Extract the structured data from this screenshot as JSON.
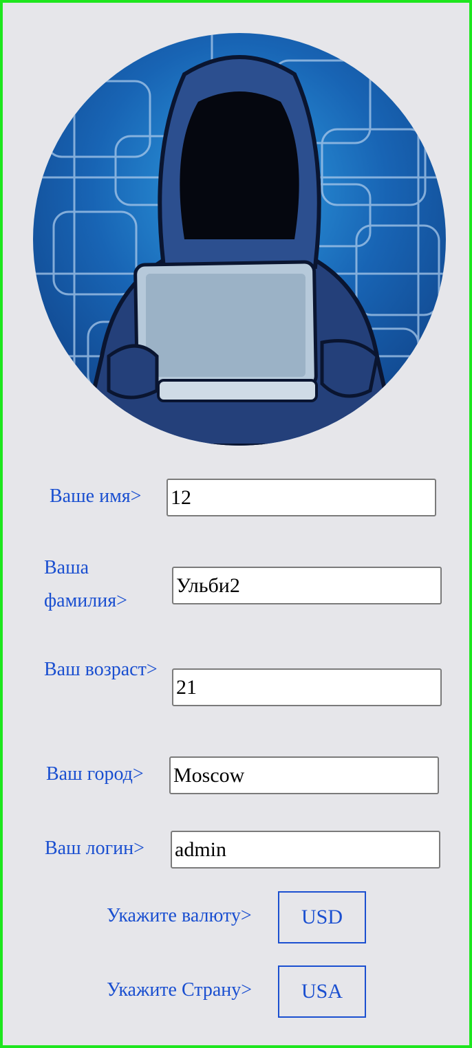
{
  "avatar": {
    "icon": "hooded-hacker-with-laptop-illustration"
  },
  "form": {
    "first_name": {
      "label": "Ваше имя>",
      "value": "12"
    },
    "last_name": {
      "label": "Ваша фамилия>",
      "value": "Ульби2"
    },
    "age": {
      "label": "Ваш возраст>",
      "value": "21"
    },
    "city": {
      "label": "Ваш город>",
      "value": "Moscow"
    },
    "login": {
      "label": "Ваш логин>",
      "value": "admin"
    },
    "currency": {
      "label": "Укажите валюту>",
      "value": "USD"
    },
    "country": {
      "label": "Укажите Страну>",
      "value": "USA"
    }
  },
  "colors": {
    "frame_border": "#1ee61e",
    "background": "#e6e6ea",
    "label_text": "#1a4fd0",
    "select_border": "#1a4fd0"
  }
}
